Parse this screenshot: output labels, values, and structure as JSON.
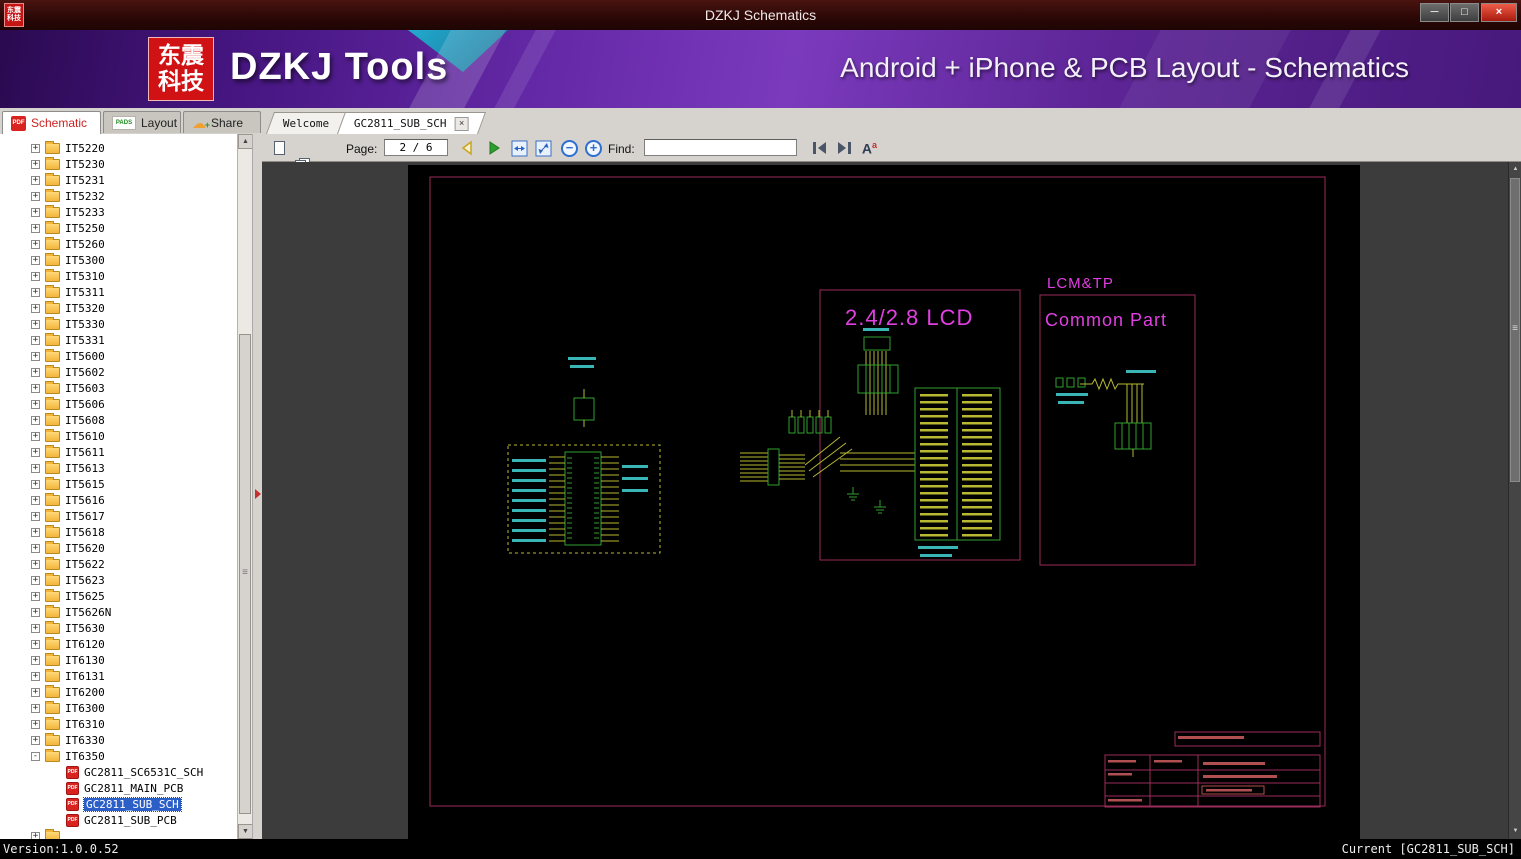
{
  "window": {
    "title": "DZKJ Schematics",
    "controls": {
      "minimize": "─",
      "maximize": "□",
      "close": "×"
    }
  },
  "banner": {
    "logo_line1": "东震",
    "logo_line2": "科技",
    "app_name": "DZKJ Tools",
    "tagline": "Android + iPhone & PCB Layout - Schematics"
  },
  "icons": {
    "pdf_badge": "PDF",
    "pads_badge": "PADS",
    "cloud": "☁",
    "share_plus": "+",
    "close_glyph": "×",
    "zoom_out": "−",
    "zoom_in": "+",
    "font_a": "A",
    "font_a_sup": "a",
    "scroll_up": "▲",
    "scroll_down": "▼",
    "grip": "≡",
    "expand_plus": "+",
    "expand_minus": "-"
  },
  "tabs": {
    "left": [
      {
        "label": "Schematic"
      },
      {
        "label": "Layout"
      },
      {
        "label": "Share"
      }
    ],
    "documents": [
      {
        "label": "Welcome"
      },
      {
        "label": "GC2811_SUB_SCH"
      }
    ]
  },
  "toolbar": {
    "page_label": "Page:",
    "page_value": "2 / 6",
    "find_label": "Find:",
    "find_value": ""
  },
  "tree": {
    "folders": [
      "IT5220",
      "IT5230",
      "IT5231",
      "IT5232",
      "IT5233",
      "IT5250",
      "IT5260",
      "IT5300",
      "IT5310",
      "IT5311",
      "IT5320",
      "IT5330",
      "IT5331",
      "IT5600",
      "IT5602",
      "IT5603",
      "IT5606",
      "IT5608",
      "IT5610",
      "IT5611",
      "IT5613",
      "IT5615",
      "IT5616",
      "IT5617",
      "IT5618",
      "IT5620",
      "IT5622",
      "IT5623",
      "IT5625",
      "IT5626N",
      "IT5630",
      "IT6120",
      "IT6130",
      "IT6131",
      "IT6200",
      "IT6300",
      "IT6310",
      "IT6330",
      "IT6350"
    ],
    "expanded_folder": "IT6350",
    "children": [
      "GC2811_SC6531C_SCH",
      "GC2811_MAIN_PCB",
      "GC2811_SUB_SCH",
      "GC2811_SUB_PCB"
    ],
    "selected_child": "GC2811_SUB_SCH"
  },
  "schematic": {
    "labels": {
      "lcd_title": "2.4/2.8  LCD",
      "lcm_title": "LCM&TP",
      "common_title": "Common  Part"
    },
    "colors": {
      "page_background": "#000000",
      "viewer_background": "#3c3c3c",
      "border": "#9b2d5a",
      "wire": "#b8b832",
      "component": "#2fa12f",
      "label": "#3ab5b5",
      "title_text": "#e13fe1",
      "titleblock_text": "#b05050"
    }
  },
  "statusbar": {
    "version": "Version:1.0.0.52",
    "current": "Current [GC2811_SUB_SCH]"
  }
}
